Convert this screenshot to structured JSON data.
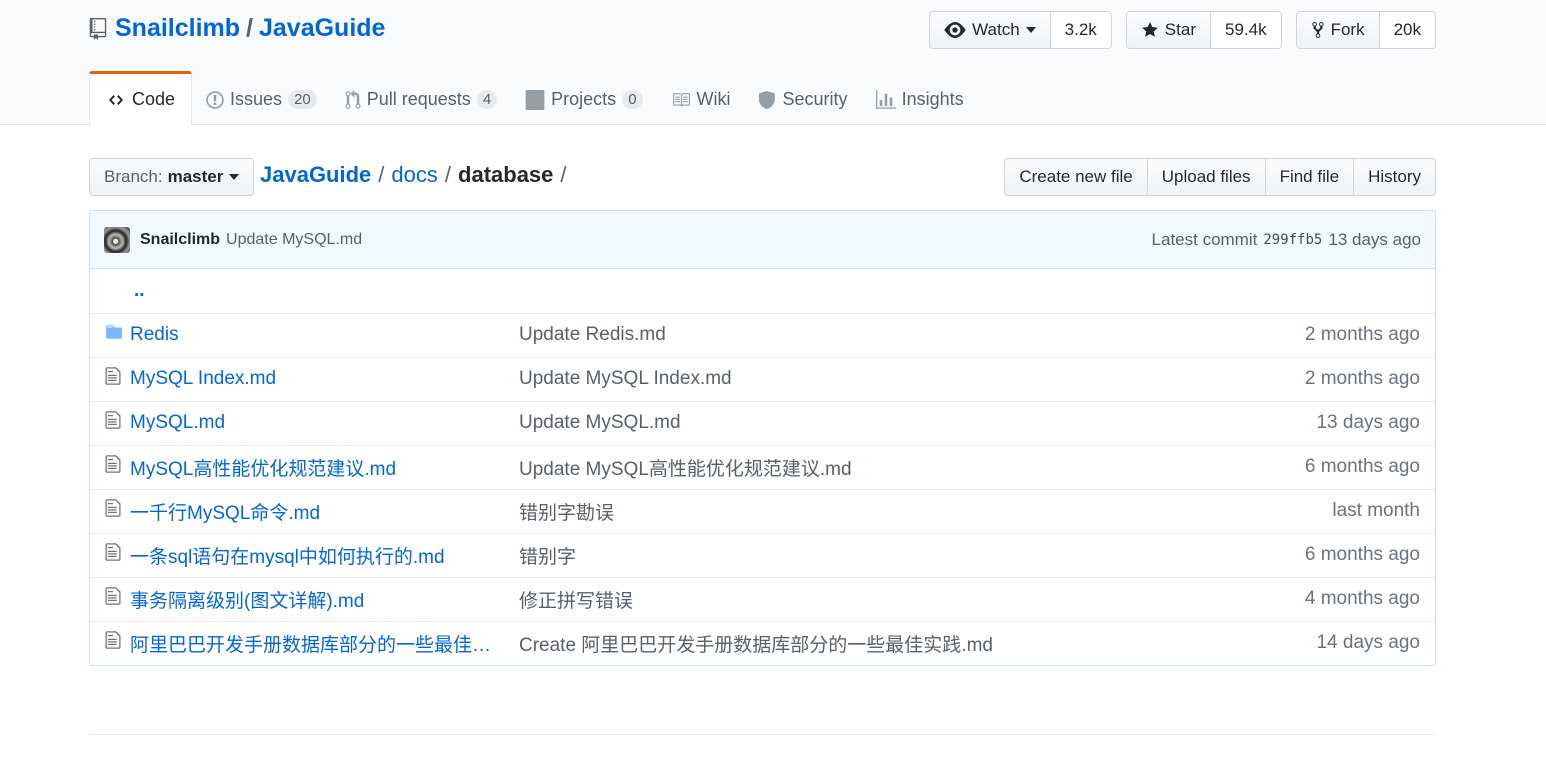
{
  "repo": {
    "owner": "Snailclimb",
    "separator": "/",
    "name": "JavaGuide"
  },
  "actions": {
    "watch": {
      "label": "Watch",
      "count": "3.2k"
    },
    "star": {
      "label": "Star",
      "count": "59.4k"
    },
    "fork": {
      "label": "Fork",
      "count": "20k"
    }
  },
  "tabs": [
    {
      "label": "Code",
      "icon": "code-icon"
    },
    {
      "label": "Issues",
      "counter": "20",
      "icon": "issue-icon"
    },
    {
      "label": "Pull requests",
      "counter": "4",
      "icon": "pull-request-icon"
    },
    {
      "label": "Projects",
      "counter": "0",
      "icon": "project-icon"
    },
    {
      "label": "Wiki",
      "icon": "book-icon"
    },
    {
      "label": "Security",
      "icon": "shield-icon"
    },
    {
      "label": "Insights",
      "icon": "graph-icon"
    }
  ],
  "branch": {
    "label": "Branch:",
    "value": "master"
  },
  "breadcrumb": {
    "root": "JavaGuide",
    "sep": "/",
    "folder": "docs",
    "current": "database"
  },
  "file_actions": {
    "create": "Create new file",
    "upload": "Upload files",
    "find": "Find file",
    "history": "History"
  },
  "commit": {
    "author": "Snailclimb",
    "message": "Update MySQL.md",
    "latest_label": "Latest commit",
    "sha": "299ffb5",
    "age": "13 days ago"
  },
  "parent_dir": "..",
  "files": [
    {
      "type": "folder",
      "name": "Redis",
      "message": "Update Redis.md",
      "age": "2 months ago"
    },
    {
      "type": "file",
      "name": "MySQL Index.md",
      "message": "Update MySQL Index.md",
      "age": "2 months ago"
    },
    {
      "type": "file",
      "name": "MySQL.md",
      "message": "Update MySQL.md",
      "age": "13 days ago"
    },
    {
      "type": "file",
      "name": "MySQL高性能优化规范建议.md",
      "message": "Update MySQL高性能优化规范建议.md",
      "age": "6 months ago"
    },
    {
      "type": "file",
      "name": "一千行MySQL命令.md",
      "message": "错别字勘误",
      "age": "last month"
    },
    {
      "type": "file",
      "name": "一条sql语句在mysql中如何执行的.md",
      "message": "错别字",
      "age": "6 months ago"
    },
    {
      "type": "file",
      "name": "事务隔离级别(图文详解).md",
      "message": "修正拼写错误",
      "age": "4 months ago"
    },
    {
      "type": "file",
      "name": "阿里巴巴开发手册数据库部分的一些最佳…",
      "message": "Create 阿里巴巴开发手册数据库部分的一些最佳实践.md",
      "age": "14 days ago"
    }
  ],
  "colors": {
    "link": "#0366d6",
    "tab_accent": "#e36209",
    "folder": "#79b8ff",
    "commit_bg": "#f1f8ff"
  }
}
